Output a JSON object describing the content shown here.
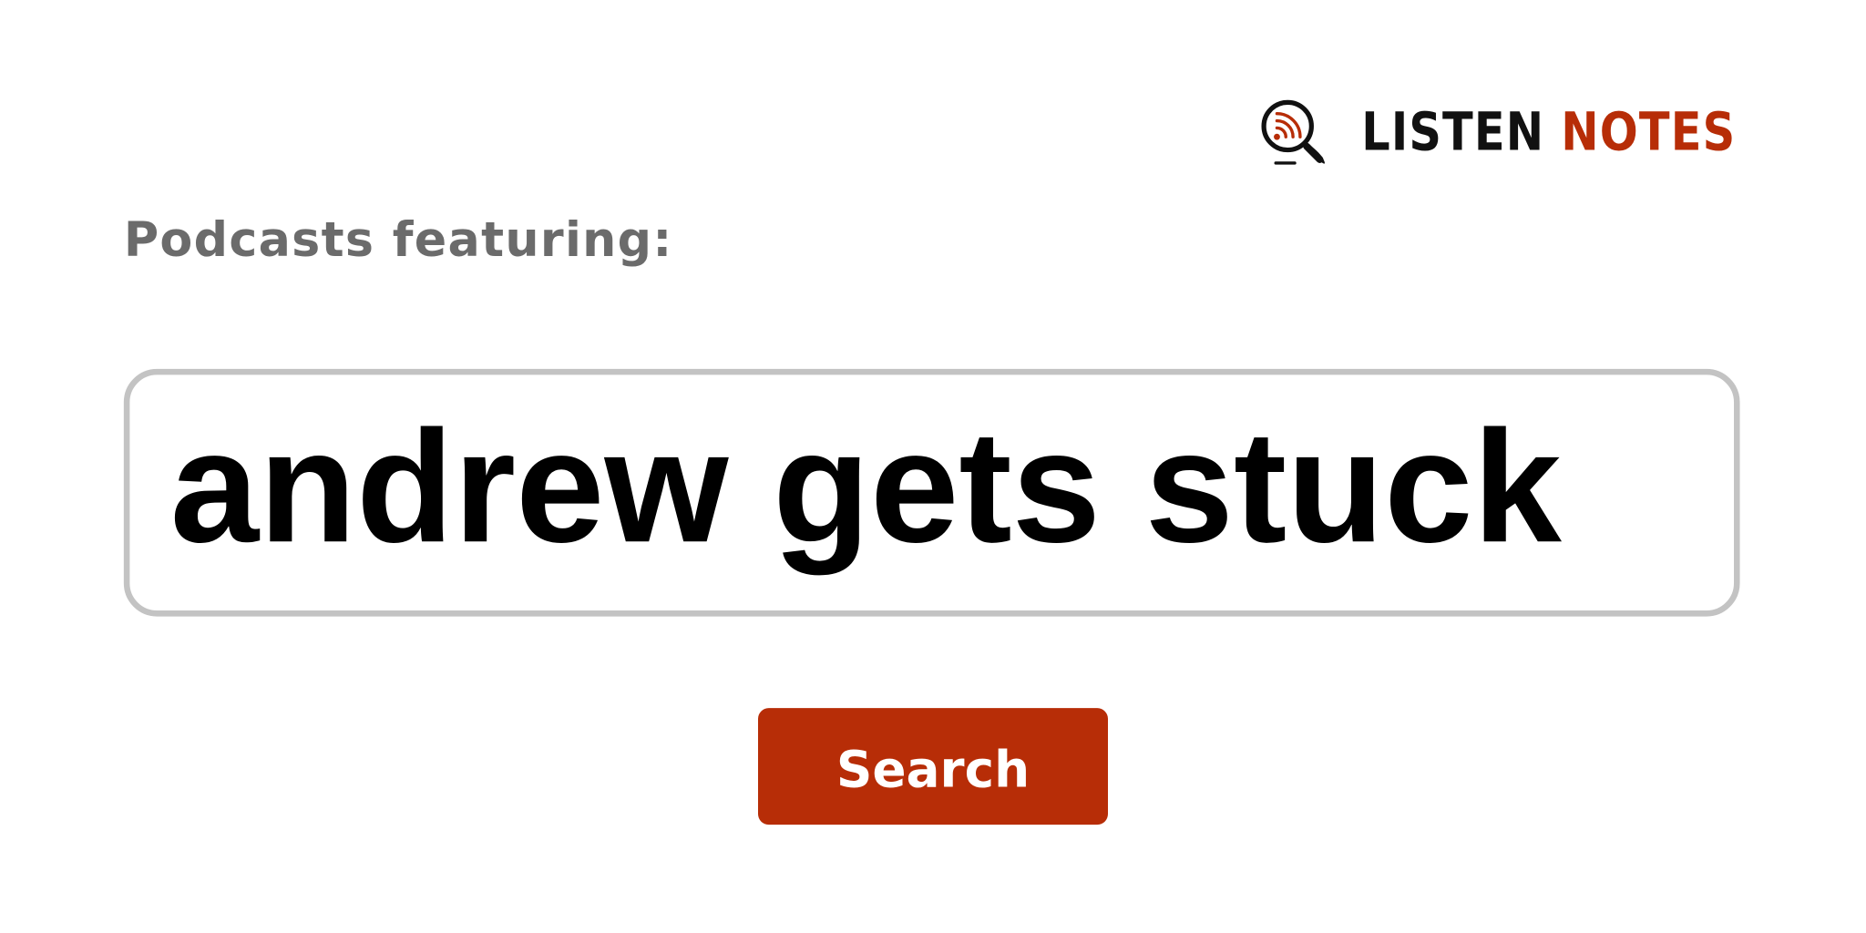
{
  "brand": {
    "name_part1": "LISTEN",
    "name_part2": "NOTES",
    "icon": "magnifier-podcast-icon",
    "color_dark": "#111111",
    "color_accent": "#b72d07"
  },
  "label": "Podcasts featuring:",
  "search": {
    "value": "andrew gets stuck"
  },
  "button": {
    "label": "Search",
    "color": "#b72d07"
  }
}
